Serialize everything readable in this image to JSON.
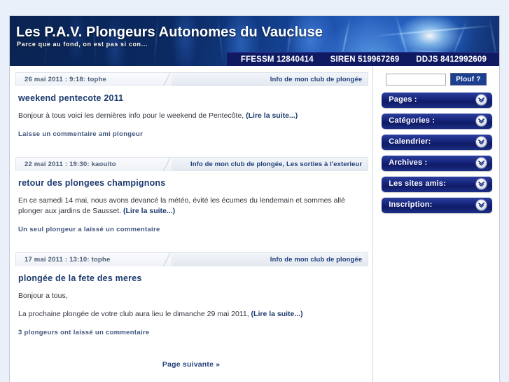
{
  "site": {
    "title": "Les P.A.V. Plongeurs Autonomes du Vaucluse",
    "tagline": "Parce que au fond, on est pas si con...",
    "registrations": [
      "FFESSM 12840414",
      "SIREN 519967269",
      "DDJS 8412992609"
    ]
  },
  "colors": {
    "banner_navy": "#0a2352",
    "reg_bar": "#101a63",
    "sidebar_button": "#16257c",
    "link_blue": "#1c3a6e",
    "page_background": "#e9f0fa"
  },
  "posts": [
    {
      "date": "26 mai 2011 : 9:18: tophe",
      "categories": "Info de mon club de plongée",
      "title": "weekend pentecote 2011",
      "body": "Bonjour à tous voici les dernières info pour le weekend de Pentecôte,",
      "more_label": "(Lire la suite...)",
      "comments": "Laisse un commentaire ami plongeur"
    },
    {
      "date": "22 mai 2011 : 19:30: kaouito",
      "categories": "Info de mon club de plongée, Les sorties à l'exterieur",
      "title": "retour des plongees champignons",
      "body": "En ce samedi 14 mai, nous avons devancé la météo, évité les écumes du lendemain et sommes allé plonger aux jardins de Sausset.",
      "more_label": "(Lire la suite...)",
      "comments": "Un seul plongeur a laissé un commentaire"
    },
    {
      "date": "17 mai 2011 : 13:10: tophe",
      "categories": "Info de mon club de plongée",
      "title": "plongée de la fete des meres",
      "body_line1": "Bonjour a tous,",
      "body": "La prochaine plongée de votre club aura lieu le dimanche 29 mai 2011,",
      "more_label": "(Lire la suite...)",
      "comments": "3 plongeurs ont laissé un commentaire"
    }
  ],
  "pager": {
    "next_label": "Page suivante »"
  },
  "sidebar": {
    "search": {
      "value": "",
      "placeholder": "",
      "button_label": "Plouf ?"
    },
    "items": [
      {
        "label": "Pages :",
        "icon": "chevron-double-down-icon"
      },
      {
        "label": "Catégories :",
        "icon": "chevron-double-down-icon"
      },
      {
        "label": "Calendrier:",
        "icon": "chevron-double-down-icon"
      },
      {
        "label": "Archives :",
        "icon": "chevron-double-down-icon"
      },
      {
        "label": "Les sites amis:",
        "icon": "chevron-double-down-icon"
      },
      {
        "label": "Inscription:",
        "icon": "chevron-double-down-icon"
      }
    ]
  }
}
